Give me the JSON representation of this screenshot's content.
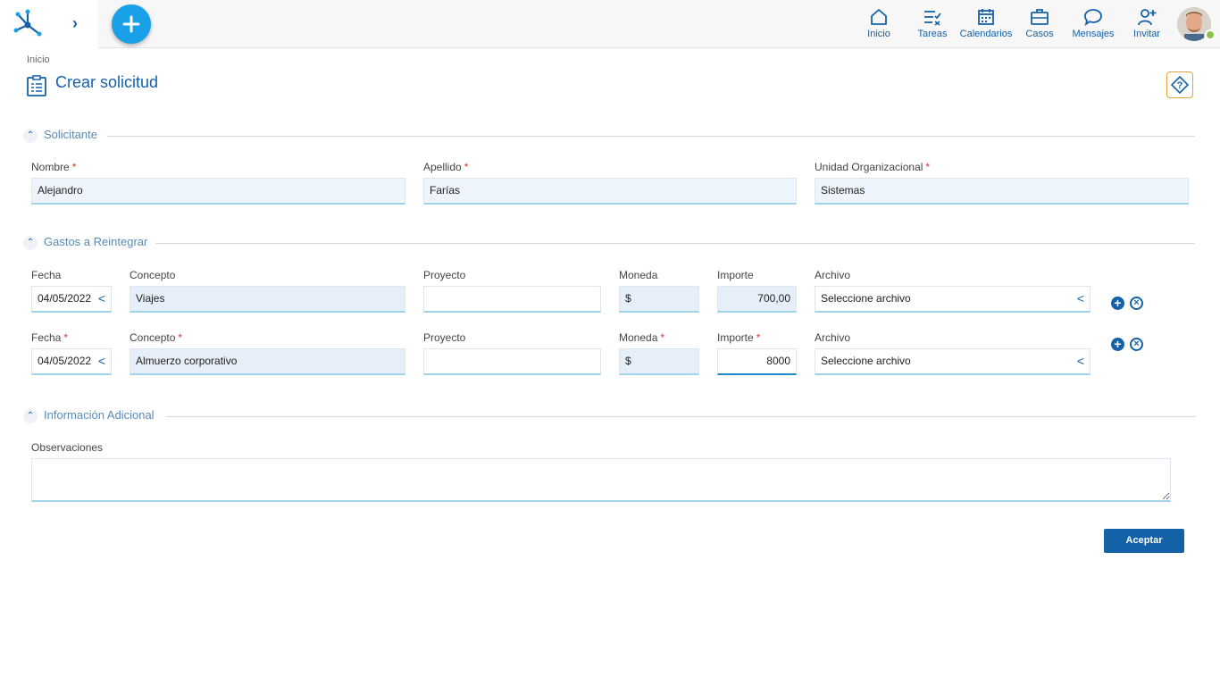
{
  "header": {
    "nav": [
      {
        "label": "Inicio",
        "icon": "home-icon"
      },
      {
        "label": "Tareas",
        "icon": "tasks-icon"
      },
      {
        "label": "Calendarios",
        "icon": "calendar-icon"
      },
      {
        "label": "Casos",
        "icon": "briefcase-icon"
      },
      {
        "label": "Mensajes",
        "icon": "chat-icon"
      },
      {
        "label": "Invitar",
        "icon": "invite-user-icon"
      }
    ]
  },
  "page": {
    "breadcrumb": "Inicio",
    "title": "Crear solicitud"
  },
  "sections": {
    "solicitante": {
      "title": "Solicitante",
      "nombre_label": "Nombre",
      "nombre_value": "Alejandro",
      "apellido_label": "Apellido",
      "apellido_value": "Farías",
      "unidad_label": "Unidad Organizacional",
      "unidad_value": "Sistemas"
    },
    "gastos": {
      "title": "Gastos a Reintegrar",
      "rows": [
        {
          "fecha_label": "Fecha",
          "fecha": "04/05/2022",
          "concepto_label": "Concepto",
          "concepto": "Viajes",
          "proyecto_label": "Proyecto",
          "proyecto": "",
          "moneda_label": "Moneda",
          "moneda": "$",
          "importe_label": "Importe",
          "importe": "700,00",
          "archivo_label": "Archivo",
          "archivo": "Seleccione archivo"
        },
        {
          "fecha_label": "Fecha",
          "fecha": "04/05/2022",
          "concepto_label": "Concepto",
          "concepto": "Almuerzo corporativo",
          "proyecto_label": "Proyecto",
          "proyecto": "",
          "moneda_label": "Moneda",
          "moneda": "$",
          "importe_label": "Importe",
          "importe": "8000",
          "archivo_label": "Archivo",
          "archivo": "Seleccione archivo"
        }
      ]
    },
    "info": {
      "title": "Información Adicional",
      "observaciones_label": "Observaciones",
      "observaciones_value": ""
    }
  },
  "actions": {
    "accept_label": "Aceptar"
  },
  "colors": {
    "primary": "#1561a8",
    "fab": "#18a0e8",
    "required": "#d9362b",
    "online": "#8bc34a"
  }
}
